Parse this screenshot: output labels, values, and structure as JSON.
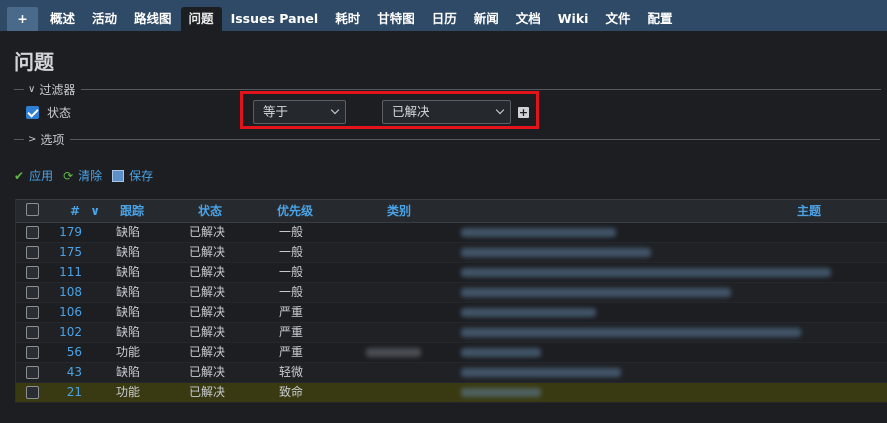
{
  "topmenu": {
    "tabs": [
      {
        "label": "+",
        "kind": "plus"
      },
      {
        "label": "概述"
      },
      {
        "label": "活动"
      },
      {
        "label": "路线图"
      },
      {
        "label": "问题",
        "active": true
      },
      {
        "label": "Issues Panel"
      },
      {
        "label": "耗时"
      },
      {
        "label": "甘特图"
      },
      {
        "label": "日历"
      },
      {
        "label": "新闻"
      },
      {
        "label": "文档"
      },
      {
        "label": "Wiki"
      },
      {
        "label": "文件"
      },
      {
        "label": "配置"
      }
    ]
  },
  "page": {
    "title": "问题"
  },
  "filters": {
    "legend": "过滤器",
    "status_label": "状态",
    "status_checked": true,
    "operator": "等于",
    "value": "已解决"
  },
  "options": {
    "legend": "选项"
  },
  "actions": {
    "apply": "应用",
    "clear": "清除",
    "save": "保存"
  },
  "table": {
    "headers": {
      "id": "#",
      "tracker": "跟踪",
      "status": "状态",
      "priority": "优先级",
      "category": "类别",
      "subject": "主题"
    },
    "rows": [
      {
        "id": "179",
        "tracker": "缺陷",
        "status": "已解决",
        "priority": "一般",
        "category_redacted": false,
        "highlight": false
      },
      {
        "id": "175",
        "tracker": "缺陷",
        "status": "已解决",
        "priority": "一般",
        "category_redacted": false,
        "highlight": false
      },
      {
        "id": "111",
        "tracker": "缺陷",
        "status": "已解决",
        "priority": "一般",
        "category_redacted": false,
        "highlight": false
      },
      {
        "id": "108",
        "tracker": "缺陷",
        "status": "已解决",
        "priority": "一般",
        "category_redacted": false,
        "highlight": false
      },
      {
        "id": "106",
        "tracker": "缺陷",
        "status": "已解决",
        "priority": "严重",
        "category_redacted": false,
        "highlight": false
      },
      {
        "id": "102",
        "tracker": "缺陷",
        "status": "已解决",
        "priority": "严重",
        "category_redacted": false,
        "highlight": false
      },
      {
        "id": "56",
        "tracker": "功能",
        "status": "已解决",
        "priority": "严重",
        "category_redacted": true,
        "highlight": false
      },
      {
        "id": "43",
        "tracker": "缺陷",
        "status": "已解决",
        "priority": "轻微",
        "category_redacted": false,
        "highlight": false
      },
      {
        "id": "21",
        "tracker": "功能",
        "status": "已解决",
        "priority": "致命",
        "category_redacted": false,
        "highlight": true
      }
    ]
  },
  "colors": {
    "topmenu_bg": "#2f4a66",
    "link": "#4aa3e6",
    "highlight_border": "#e0141a",
    "row_highlight": "#3a3a12"
  }
}
